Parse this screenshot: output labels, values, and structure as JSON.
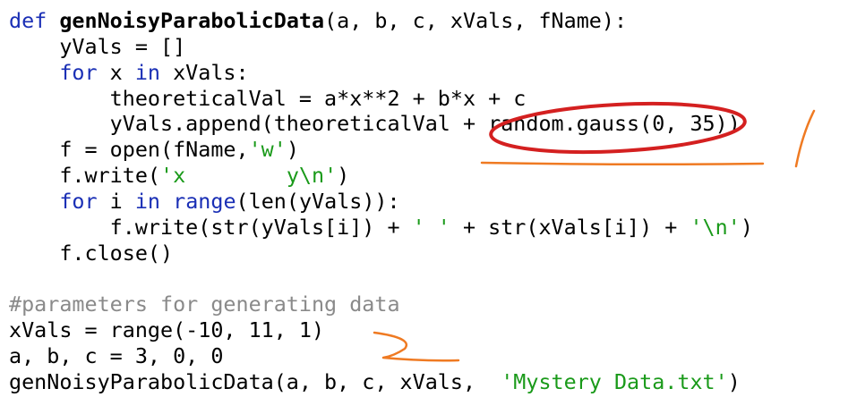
{
  "lines": [
    [
      {
        "t": "def ",
        "c": "kw"
      },
      {
        "t": "genNoisyParabolicData",
        "c": "fn"
      },
      {
        "t": "(a, b, c, xVals, fName):",
        "c": ""
      }
    ],
    [
      {
        "t": "    yVals = []",
        "c": ""
      }
    ],
    [
      {
        "t": "    ",
        "c": ""
      },
      {
        "t": "for",
        "c": "kw"
      },
      {
        "t": " x ",
        "c": ""
      },
      {
        "t": "in",
        "c": "kw"
      },
      {
        "t": " xVals:",
        "c": ""
      }
    ],
    [
      {
        "t": "        theoreticalVal = a*x**2 + b*x + c",
        "c": ""
      }
    ],
    [
      {
        "t": "        yVals.append(theoreticalVal + random.gauss(0, 35))",
        "c": ""
      }
    ],
    [
      {
        "t": "    f = open(fName,",
        "c": ""
      },
      {
        "t": "'w'",
        "c": "str"
      },
      {
        "t": ")",
        "c": ""
      }
    ],
    [
      {
        "t": "    f.write(",
        "c": ""
      },
      {
        "t": "'x        y\\n'",
        "c": "str"
      },
      {
        "t": ")",
        "c": ""
      }
    ],
    [
      {
        "t": "    ",
        "c": ""
      },
      {
        "t": "for",
        "c": "kw"
      },
      {
        "t": " i ",
        "c": ""
      },
      {
        "t": "in",
        "c": "kw"
      },
      {
        "t": " ",
        "c": ""
      },
      {
        "t": "range",
        "c": "kw"
      },
      {
        "t": "(len(yVals)):",
        "c": ""
      }
    ],
    [
      {
        "t": "        f.write(str(yVals[i]) + ",
        "c": ""
      },
      {
        "t": "' '",
        "c": "str"
      },
      {
        "t": " + str(xVals[i]) + ",
        "c": ""
      },
      {
        "t": "'\\n'",
        "c": "str"
      },
      {
        "t": ")",
        "c": ""
      }
    ],
    [
      {
        "t": "    f.close()",
        "c": ""
      }
    ],
    [],
    [
      {
        "t": "#parameters for generating data",
        "c": "cmt"
      }
    ],
    [
      {
        "t": "xVals = range(-10, 11, 1)",
        "c": ""
      }
    ],
    [
      {
        "t": "a, b, c = 3, 0, 0",
        "c": ""
      }
    ],
    [
      {
        "t": "genNoisyParabolicData(a, b, c, xVals,  ",
        "c": ""
      },
      {
        "t": "'Mystery Data.txt'",
        "c": "str"
      },
      {
        "t": ")",
        "c": ""
      }
    ]
  ],
  "colors": {
    "keyword": "#1a2fb5",
    "string": "#1a9a1a",
    "comment": "#8a8a8a",
    "circle_annotation": "#d42020",
    "pen_annotation": "#ef7a22"
  }
}
